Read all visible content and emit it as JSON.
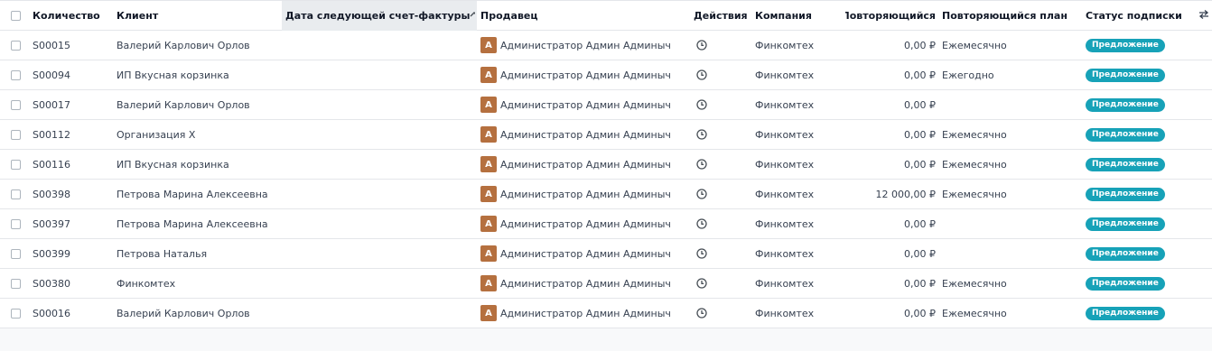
{
  "columns": {
    "number": "Количество",
    "client": "Клиент",
    "next_invoice_date": "Дата следующей счет-фактуры",
    "salesperson": "Продавец",
    "actions": "Действия",
    "company": "Компания",
    "recurring": "Повторяющийся",
    "recurring_plan": "Повторяющийся план",
    "status": "Статус подписки"
  },
  "icons": {
    "sort": "chevron-up-icon",
    "activity": "clock-icon",
    "optional_columns": "sliders-icon"
  },
  "colors": {
    "avatar": "#b5703f",
    "status_badge": "#17a2b8"
  },
  "rows": [
    {
      "number": "S00015",
      "client": "Валерий Карлович Орлов",
      "avatar": "A",
      "salesperson": "Администратор Админ Админыч",
      "company": "Финкомтех",
      "recurring": "0,00 ₽",
      "plan": "Ежемесячно",
      "status": "Предложение"
    },
    {
      "number": "S00094",
      "client": "ИП Вкусная корзинка",
      "avatar": "A",
      "salesperson": "Администратор Админ Админыч",
      "company": "Финкомтех",
      "recurring": "0,00 ₽",
      "plan": "Ежегодно",
      "status": "Предложение"
    },
    {
      "number": "S00017",
      "client": "Валерий Карлович Орлов",
      "avatar": "A",
      "salesperson": "Администратор Админ Админыч",
      "company": "Финкомтех",
      "recurring": "0,00 ₽",
      "plan": "",
      "status": "Предложение"
    },
    {
      "number": "S00112",
      "client": "Организация Х",
      "avatar": "A",
      "salesperson": "Администратор Админ Админыч",
      "company": "Финкомтех",
      "recurring": "0,00 ₽",
      "plan": "Ежемесячно",
      "status": "Предложение"
    },
    {
      "number": "S00116",
      "client": "ИП Вкусная корзинка",
      "avatar": "A",
      "salesperson": "Администратор Админ Админыч",
      "company": "Финкомтех",
      "recurring": "0,00 ₽",
      "plan": "Ежемесячно",
      "status": "Предложение"
    },
    {
      "number": "S00398",
      "client": "Петрова Марина Алексеевна",
      "avatar": "A",
      "salesperson": "Администратор Админ Админыч",
      "company": "Финкомтех",
      "recurring": "12 000,00 ₽",
      "plan": "Ежемесячно",
      "status": "Предложение"
    },
    {
      "number": "S00397",
      "client": "Петрова Марина Алексеевна",
      "avatar": "A",
      "salesperson": "Администратор Админ Админыч",
      "company": "Финкомтех",
      "recurring": "0,00 ₽",
      "plan": "",
      "status": "Предложение"
    },
    {
      "number": "S00399",
      "client": "Петрова Наталья",
      "avatar": "A",
      "salesperson": "Администратор Админ Админыч",
      "company": "Финкомтех",
      "recurring": "0,00 ₽",
      "plan": "",
      "status": "Предложение"
    },
    {
      "number": "S00380",
      "client": "Финкомтех",
      "avatar": "A",
      "salesperson": "Администратор Админ Админыч",
      "company": "Финкомтех",
      "recurring": "0,00 ₽",
      "plan": "Ежемесячно",
      "status": "Предложение"
    },
    {
      "number": "S00016",
      "client": "Валерий Карлович Орлов",
      "avatar": "A",
      "salesperson": "Администратор Админ Админыч",
      "company": "Финкомтех",
      "recurring": "0,00 ₽",
      "plan": "Ежемесячно",
      "status": "Предложение"
    }
  ]
}
